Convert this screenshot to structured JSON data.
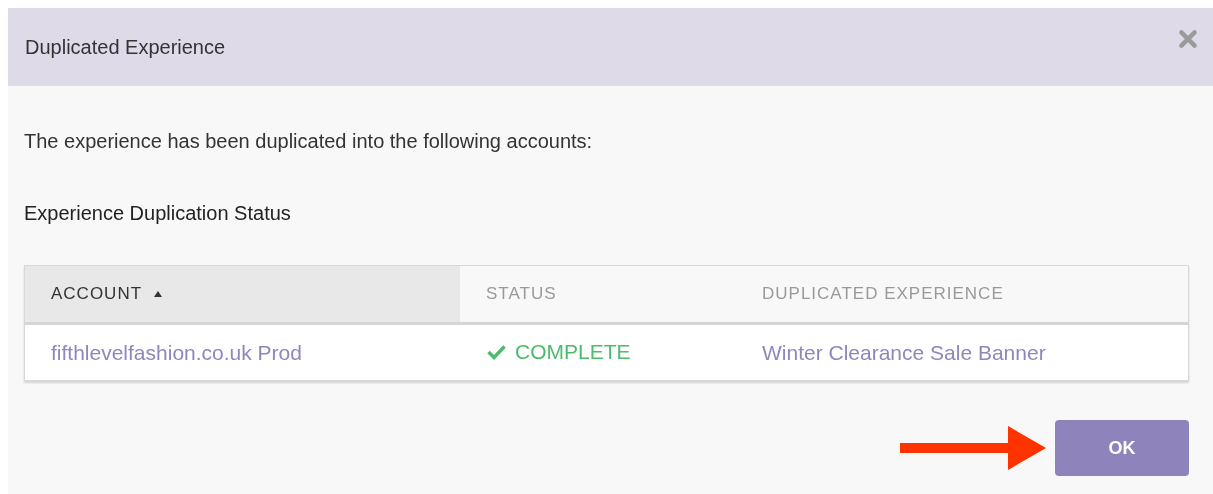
{
  "dialog": {
    "title": "Duplicated Experience",
    "message": "The experience has been duplicated into the following accounts:",
    "section_title": "Experience Duplication Status"
  },
  "table": {
    "columns": [
      {
        "label": "ACCOUNT",
        "selected": true,
        "sorted": true
      },
      {
        "label": "STATUS",
        "selected": false
      },
      {
        "label": "DUPLICATED EXPERIENCE",
        "selected": false
      }
    ],
    "rows": [
      {
        "account": "fifthlevelfashion.co.uk Prod",
        "status": "COMPLETE",
        "complete": true,
        "experience": "Winter Clearance Sale Banner"
      }
    ]
  },
  "buttons": [
    {
      "label": "OK"
    }
  ]
}
